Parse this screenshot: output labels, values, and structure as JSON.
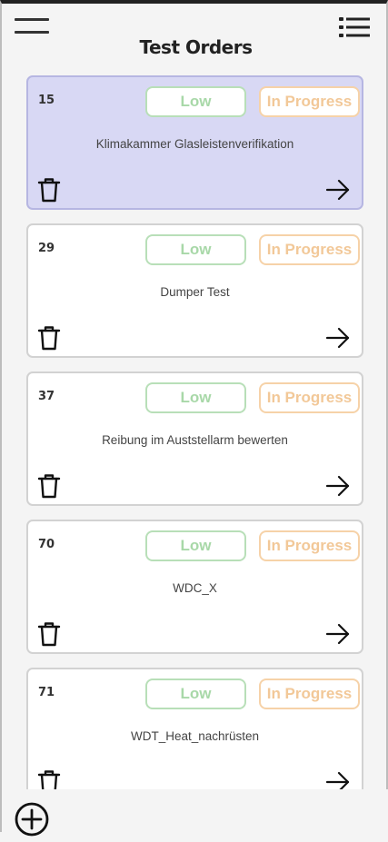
{
  "header": {
    "title": "Test Orders",
    "menu_icon": "hamburger-menu-icon",
    "list_icon": "bulleted-list-icon"
  },
  "orders": [
    {
      "id": "15",
      "priority": "Low",
      "status": "In Progress",
      "name": "Klimakammer Glasleistenverifikation",
      "selected": true
    },
    {
      "id": "29",
      "priority": "Low",
      "status": "In Progress",
      "name": "Dumper Test",
      "selected": false
    },
    {
      "id": "37",
      "priority": "Low",
      "status": "In Progress",
      "name": "Reibung im Auststellarm bewerten",
      "selected": false
    },
    {
      "id": "70",
      "priority": "Low",
      "status": "In Progress",
      "name": "WDC_X",
      "selected": false
    },
    {
      "id": "71",
      "priority": "Low",
      "status": "In Progress",
      "name": "WDT_Heat_nachrüsten",
      "selected": false
    }
  ],
  "icons": {
    "delete": "trash-icon",
    "open": "arrow-right-icon",
    "add": "add-circle-icon"
  },
  "colors": {
    "selected_card_bg": "#d8d8f4",
    "priority_low": "#a8d8a8",
    "status_in_progress": "#f2c898"
  }
}
